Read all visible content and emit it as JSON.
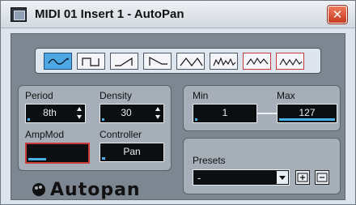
{
  "window": {
    "title": "MIDI 01 Insert 1 - AutoPan",
    "close_glyph": "✕"
  },
  "waveforms": [
    {
      "name": "sine",
      "active": true
    },
    {
      "name": "square",
      "active": false
    },
    {
      "name": "saw-up",
      "active": false
    },
    {
      "name": "saw-down",
      "active": false
    },
    {
      "name": "triangle",
      "active": false
    },
    {
      "name": "random-a",
      "active": false
    },
    {
      "name": "random-b",
      "active": false
    },
    {
      "name": "random-c",
      "active": false
    }
  ],
  "controls": {
    "period": {
      "label": "Period",
      "value": "8th",
      "level": 0.05
    },
    "density": {
      "label": "Density",
      "value": "30",
      "level": 0.05
    },
    "ampmod": {
      "label": "AmpMod",
      "value": "",
      "level": 0.3
    },
    "controller": {
      "label": "Controller",
      "value": "Pan",
      "level": 0.05
    }
  },
  "range": {
    "min": {
      "label": "Min",
      "value": "1",
      "level": 0.02
    },
    "max": {
      "label": "Max",
      "value": "127",
      "level": 1.0
    }
  },
  "presets": {
    "label": "Presets",
    "value": "-",
    "store_icon": "store-preset-icon",
    "remove_icon": "remove-preset-icon"
  },
  "brand": {
    "name": "Autopan"
  },
  "colors": {
    "accent": "#4da7e3",
    "highlight": "#c93a3a",
    "panel": "#a6aeb7",
    "field_bg": "#0c0f12"
  }
}
